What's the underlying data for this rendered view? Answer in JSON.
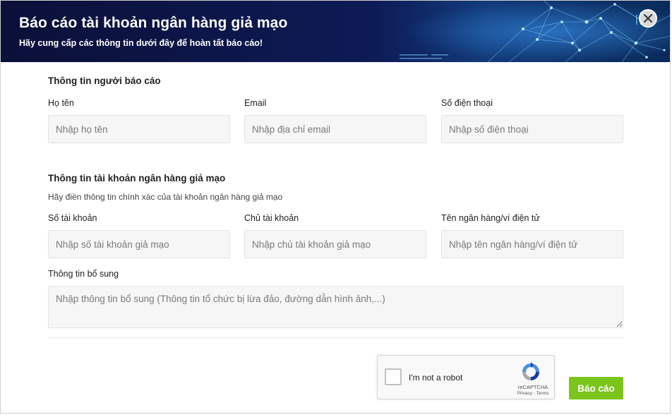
{
  "header": {
    "title": "Báo cáo tài khoản ngân hàng giả mạo",
    "subtitle": "Hãy cung cấp các thông tin dưới đây để hoàn tất báo cáo!"
  },
  "reporter": {
    "section_title": "Thông tin người báo cáo",
    "name": {
      "label": "Họ tên",
      "placeholder": "Nhập họ tên",
      "value": ""
    },
    "email": {
      "label": "Email",
      "placeholder": "Nhập địa chỉ email",
      "value": ""
    },
    "phone": {
      "label": "Số điện thoại",
      "placeholder": "Nhập số điện thoại",
      "value": ""
    }
  },
  "fake_account": {
    "section_title": "Thông tin tài khoản ngân hàng giả mạo",
    "description": "Hãy điền thông tin chính xác của tài khoản ngân hàng giả mạo",
    "account_number": {
      "label": "Số tài khoản",
      "placeholder": "Nhập số tài khoản giả mạo",
      "value": ""
    },
    "account_holder": {
      "label": "Chủ tài khoản",
      "placeholder": "Nhập chủ tài khoản giả mạo",
      "value": ""
    },
    "bank_name": {
      "label": "Tên ngân hàng/ví điện tử",
      "placeholder": "Nhập tên ngân hàng/ví điện tử",
      "value": ""
    }
  },
  "additional": {
    "label": "Thông tin bổ sung",
    "placeholder": "Nhập thông tin bổ sung (Thông tin tổ chức bị lừa đảo, đường dẫn hình ảnh,...)",
    "value": ""
  },
  "recaptcha": {
    "label": "I'm not a robot",
    "brand": "reCAPTCHA",
    "links": "Privacy - Terms",
    "checked": false
  },
  "submit_label": "Báo cáo",
  "colors": {
    "accent": "#7bc41c",
    "header_bg": "#0d1a55"
  }
}
